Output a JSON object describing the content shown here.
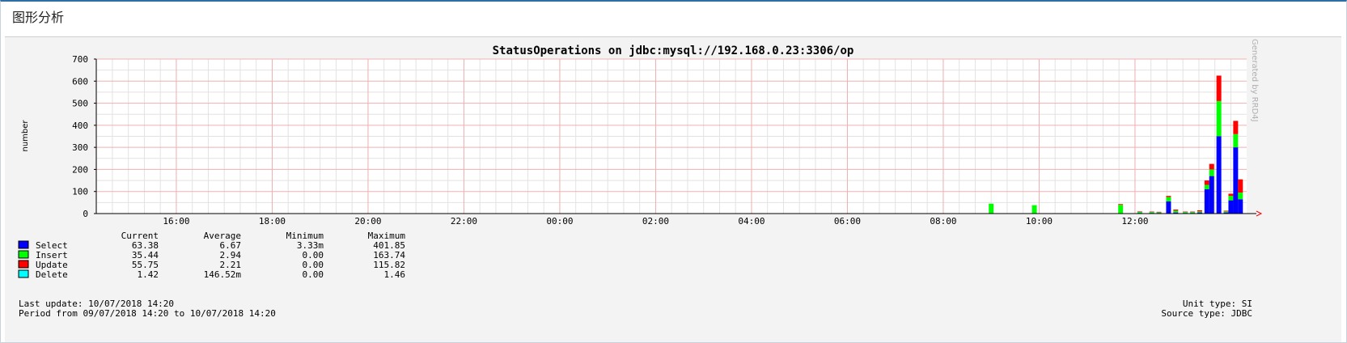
{
  "panel": {
    "title": "图形分析"
  },
  "chart_data": {
    "type": "bar",
    "stacked": true,
    "title": "StatusOperations on jdbc:mysql://192.168.0.23:3306/op",
    "ylabel": "number",
    "watermark": "Generated by RRD4J",
    "ylim": [
      0,
      700
    ],
    "yticks": [
      0,
      100,
      200,
      300,
      400,
      500,
      600,
      700
    ],
    "xlim": [
      14.33,
      38.33
    ],
    "xticks": [
      {
        "x": 16,
        "label": "16:00"
      },
      {
        "x": 18,
        "label": "18:00"
      },
      {
        "x": 20,
        "label": "20:00"
      },
      {
        "x": 22,
        "label": "22:00"
      },
      {
        "x": 24,
        "label": "00:00"
      },
      {
        "x": 26,
        "label": "02:00"
      },
      {
        "x": 28,
        "label": "04:00"
      },
      {
        "x": 30,
        "label": "06:00"
      },
      {
        "x": 32,
        "label": "08:00"
      },
      {
        "x": 34,
        "label": "10:00"
      },
      {
        "x": 36,
        "label": "12:00"
      }
    ],
    "grid": true,
    "colors": {
      "Select": "#0000ff",
      "Insert": "#00ff00",
      "Update": "#ff0000",
      "Delete": "#00ffff"
    },
    "x": [
      33.0,
      33.9,
      35.7,
      36.1,
      36.35,
      36.5,
      36.7,
      36.85,
      37.05,
      37.2,
      37.35,
      37.5,
      37.6,
      37.75,
      37.9,
      38.0,
      38.1,
      38.2
    ],
    "series": [
      {
        "name": "Select",
        "values": [
          0,
          0,
          0,
          3,
          3,
          3,
          55,
          5,
          3,
          3,
          5,
          110,
          170,
          350,
          5,
          60,
          300,
          65
        ]
      },
      {
        "name": "Insert",
        "values": [
          45,
          38,
          40,
          5,
          4,
          3,
          20,
          8,
          4,
          4,
          5,
          20,
          30,
          160,
          5,
          20,
          60,
          30
        ]
      },
      {
        "name": "Update",
        "values": [
          0,
          0,
          3,
          2,
          2,
          2,
          5,
          5,
          2,
          2,
          5,
          20,
          25,
          115,
          3,
          10,
          60,
          60
        ]
      },
      {
        "name": "Delete",
        "values": [
          0,
          0,
          0,
          0,
          0,
          0,
          0,
          0,
          0,
          0,
          0,
          0,
          0,
          0,
          0,
          0,
          0,
          0
        ]
      }
    ],
    "legend": {
      "headers": [
        "Current",
        "Average",
        "Minimum",
        "Maximum"
      ],
      "rows": [
        {
          "name": "Select",
          "current": "63.38",
          "average": "6.67",
          "minimum": "3.33m",
          "maximum": "401.85"
        },
        {
          "name": "Insert",
          "current": "35.44",
          "average": "2.94",
          "minimum": "0.00",
          "maximum": "163.74"
        },
        {
          "name": "Update",
          "current": "55.75",
          "average": "2.21",
          "minimum": "0.00",
          "maximum": "115.82"
        },
        {
          "name": "Delete",
          "current": "1.42",
          "average": "146.52m",
          "minimum": "0.00",
          "maximum": "1.46"
        }
      ]
    },
    "footer": {
      "last_update": "Last update: 10/07/2018 14:20",
      "period": "Period from 09/07/2018 14:20 to 10/07/2018 14:20",
      "unit_type": "Unit type: SI",
      "source_type": "Source type: JDBC"
    }
  }
}
